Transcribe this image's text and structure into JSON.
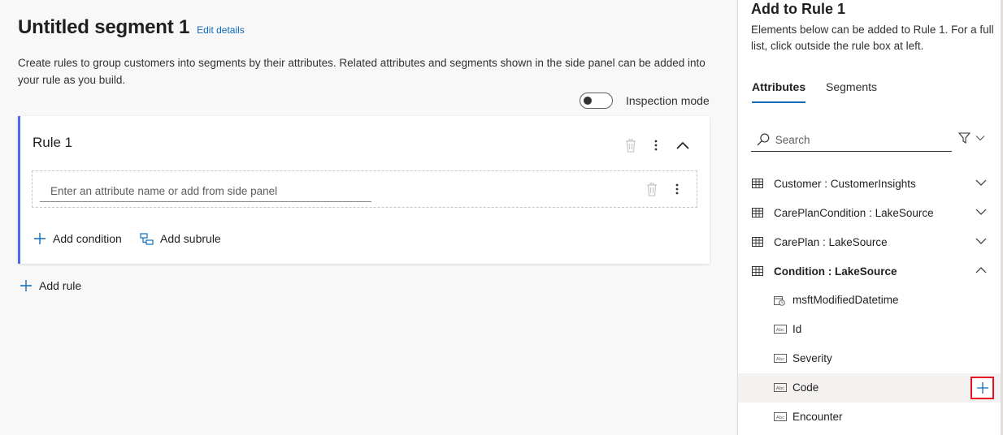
{
  "segment": {
    "title": "Untitled segment 1",
    "edit_link": "Edit details",
    "description": "Create rules to group customers into segments by their attributes. Related attributes and segments shown in the side panel can be added into your rule as you build.",
    "inspection_mode_label": "Inspection mode",
    "inspection_mode_on": false
  },
  "rule": {
    "title": "Rule 1",
    "condition_placeholder": "Enter an attribute name or add from side panel",
    "add_condition_label": "Add condition",
    "add_subrule_label": "Add subrule"
  },
  "add_rule_label": "Add rule",
  "side_panel": {
    "title": "Add to Rule 1",
    "description": "Elements below can be added to Rule 1. For a full list, click outside the rule box at left.",
    "tabs": [
      {
        "label": "Attributes",
        "active": true
      },
      {
        "label": "Segments",
        "active": false
      }
    ],
    "search_placeholder": "Search",
    "entities": [
      {
        "label": "Customer : CustomerInsights",
        "expanded": false,
        "icon": "table-icon"
      },
      {
        "label": "CarePlanCondition : LakeSource",
        "expanded": false,
        "icon": "table-icon"
      },
      {
        "label": "CarePlan : LakeSource",
        "expanded": false,
        "icon": "table-icon"
      },
      {
        "label": "Condition : LakeSource",
        "expanded": true,
        "icon": "table-icon"
      }
    ],
    "attributes": [
      {
        "label": "msftModifiedDatetime",
        "icon": "datetime-icon"
      },
      {
        "label": "Id",
        "icon": "text-field-icon"
      },
      {
        "label": "Severity",
        "icon": "text-field-icon"
      },
      {
        "label": "Code",
        "icon": "text-field-icon",
        "hovered": true
      },
      {
        "label": "Encounter",
        "icon": "text-field-icon"
      }
    ]
  },
  "colors": {
    "accent": "#0f6cbd",
    "rule_border": "#4f6bed",
    "highlight_box": "#e81123"
  }
}
